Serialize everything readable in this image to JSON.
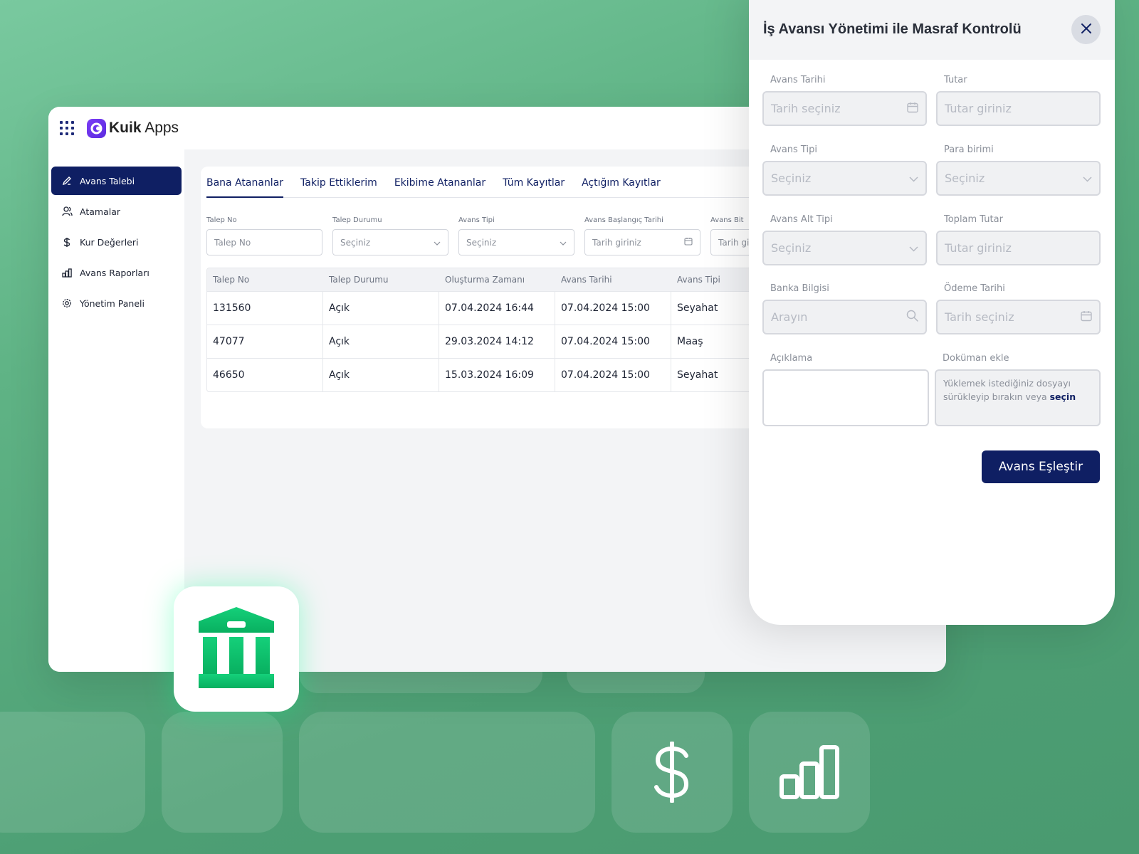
{
  "app": {
    "logo_bold": "Kuik",
    "logo_light": " Apps"
  },
  "sidebar": {
    "items": [
      {
        "label": "Avans Talebi",
        "icon": "pencil-icon",
        "active": true
      },
      {
        "label": "Atamalar",
        "icon": "users-icon"
      },
      {
        "label": "Kur Değerleri",
        "icon": "dollar-icon"
      },
      {
        "label": "Avans Raporları",
        "icon": "bar-chart-icon"
      },
      {
        "label": "Yönetim Paneli",
        "icon": "gear-icon"
      }
    ]
  },
  "tabs": [
    {
      "label": "Bana Atananlar",
      "active": true
    },
    {
      "label": "Takip Ettiklerim"
    },
    {
      "label": "Ekibime Atananlar"
    },
    {
      "label": "Tüm Kayıtlar"
    },
    {
      "label": "Açtığım Kayıtlar"
    }
  ],
  "filters": [
    {
      "label": "Talep No",
      "placeholder": "Talep No"
    },
    {
      "label": "Talep Durumu",
      "placeholder": "Seçiniz"
    },
    {
      "label": "Avans Tipi",
      "placeholder": "Seçiniz"
    },
    {
      "label": "Avans Başlangıç Tarihi",
      "placeholder": "Tarih giriniz"
    },
    {
      "label": "Avans Bit",
      "placeholder": "Tarih gi"
    }
  ],
  "table": {
    "headers": [
      "Talep No",
      "Talep Durumu",
      "Oluşturma Zamanı",
      "Avans Tarihi",
      "Avans Tipi"
    ],
    "rows": [
      [
        "131560",
        "Açık",
        "07.04.2024 16:44",
        "07.04.2024 15:00",
        "Seyahat"
      ],
      [
        "47077",
        "Açık",
        "29.03.2024 14:12",
        "07.04.2024 15:00",
        "Maaş"
      ],
      [
        "46650",
        "Açık",
        "15.03.2024 16:09",
        "07.04.2024 15:00",
        "Seyahat"
      ]
    ]
  },
  "panel": {
    "title": "İş Avansı Yönetimi ile Masraf Kontrolü",
    "fields": {
      "avans_tarihi": {
        "label": "Avans Tarihi",
        "placeholder": "Tarih seçiniz"
      },
      "tutar": {
        "label": "Tutar",
        "placeholder": "Tutar giriniz"
      },
      "avans_tipi": {
        "label": "Avans Tipi",
        "placeholder": "Seçiniz"
      },
      "para_birimi": {
        "label": "Para birimi",
        "placeholder": "Seçiniz"
      },
      "avans_alt_tipi": {
        "label": "Avans Alt Tipi",
        "placeholder": "Seçiniz"
      },
      "toplam_tutar": {
        "label": "Toplam Tutar",
        "placeholder": "Tutar giriniz"
      },
      "banka_bilgisi": {
        "label": "Banka Bilgisi",
        "placeholder": "Arayın"
      },
      "odeme_tarihi": {
        "label": "Ödeme Tarihi",
        "placeholder": "Tarih seçiniz"
      },
      "aciklama": {
        "label": "Açıklama"
      },
      "dokuman": {
        "label": "Doküman ekle",
        "text": "Yüklemek istediğiniz dosyayı sürükleyip bırakın veya ",
        "link": "seçin"
      }
    },
    "submit": "Avans Eşleştir"
  },
  "colors": {
    "primary": "#0f1f63",
    "brand_purple": "#6a33ea",
    "bank_green": "#0dbd6a"
  }
}
